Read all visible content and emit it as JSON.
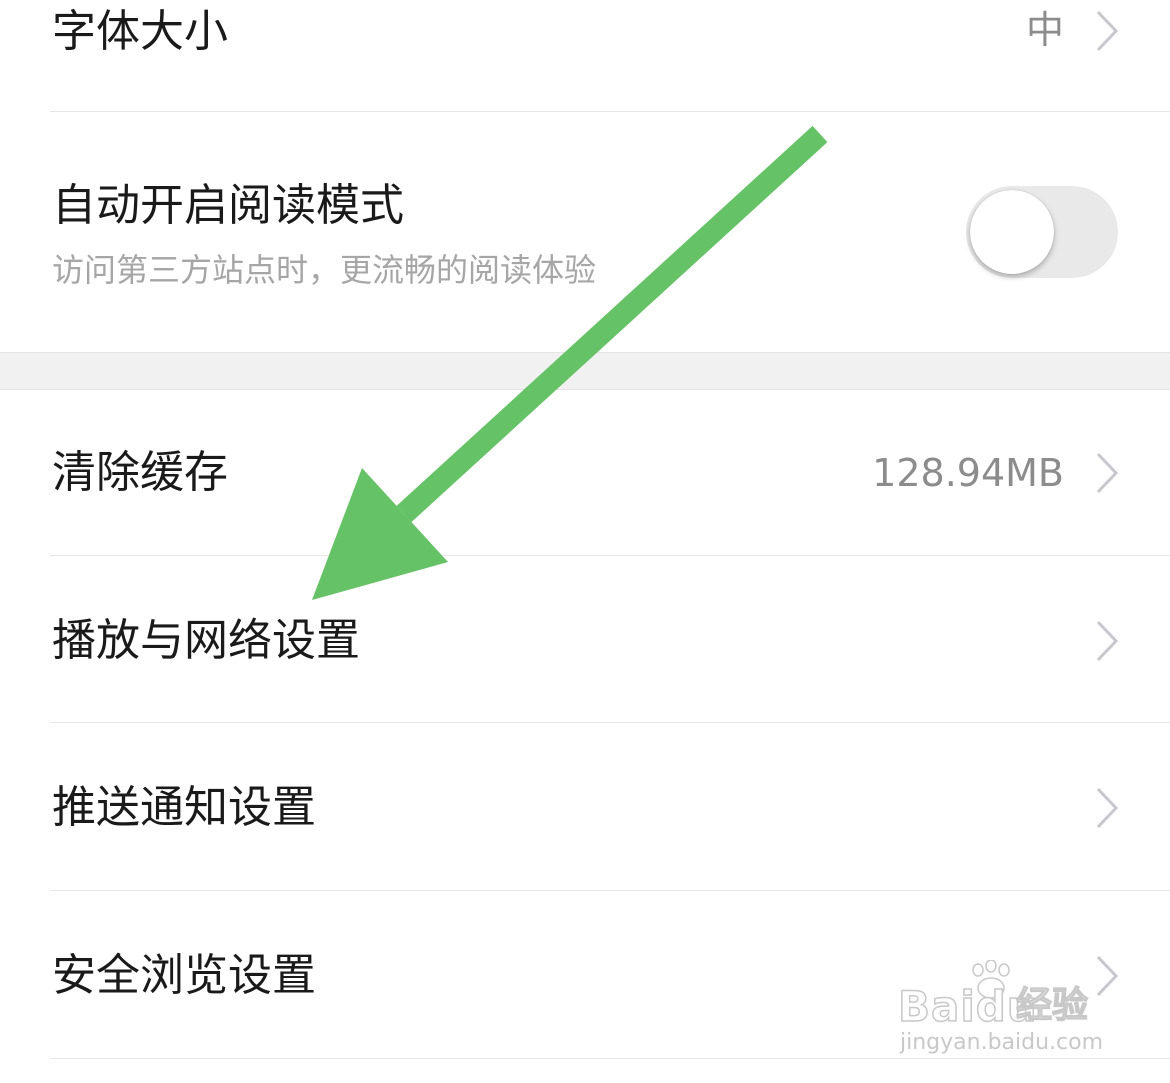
{
  "settings": {
    "font_size": {
      "label": "字体大小",
      "value": "中"
    },
    "auto_reader": {
      "label": "自动开启阅读模式",
      "subtitle": "访问第三方站点时，更流畅的阅读体验",
      "enabled": false
    },
    "clear_cache": {
      "label": "清除缓存",
      "value": "128.94MB"
    },
    "playback_network": {
      "label": "播放与网络设置"
    },
    "push_notification": {
      "label": "推送通知设置"
    },
    "safe_browsing": {
      "label": "安全浏览设置"
    }
  },
  "annotation": {
    "arrow_color": "#66c266"
  },
  "watermark": {
    "brand": "Bai",
    "brand_suffix": "du",
    "product": "经验",
    "url": "jingyan.baidu.com"
  },
  "colors": {
    "text_primary": "#1a1a1a",
    "text_secondary": "#a6a6a6",
    "value_text": "#8c8c8c",
    "divider": "#e6e6e6",
    "section_gap": "#f1f1f1",
    "toggle_off": "#e9e9ea"
  },
  "icons": {
    "chevron": "chevron-right-icon",
    "toggle": "toggle-switch",
    "arrow": "arrow-annotation-icon",
    "paw": "baidu-paw-icon"
  }
}
